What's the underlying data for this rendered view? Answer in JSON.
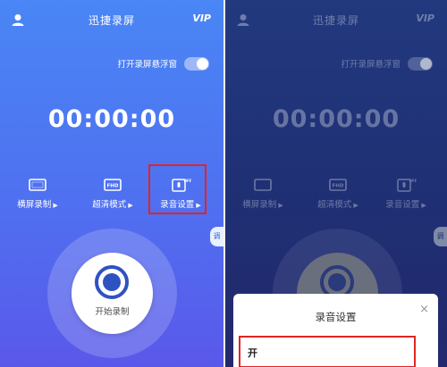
{
  "app": {
    "title": "迅捷录屏",
    "vip_label": "VIP",
    "float_window_label": "打开录屏悬浮窗",
    "timer": "00:00:00",
    "side_tab_label": "调"
  },
  "modes": [
    {
      "label": "横屏录制",
      "icon": "landscape-screen-icon"
    },
    {
      "label": "超清模式",
      "icon": "fhd-icon"
    },
    {
      "label": "录音设置",
      "icon": "mic-off-icon"
    }
  ],
  "record": {
    "label": "开始录制"
  },
  "sheet": {
    "title": "录音设置",
    "close_symbol": "×",
    "option": "开"
  },
  "colors": {
    "highlight": "#e22424",
    "accent": "#2f52c2"
  }
}
